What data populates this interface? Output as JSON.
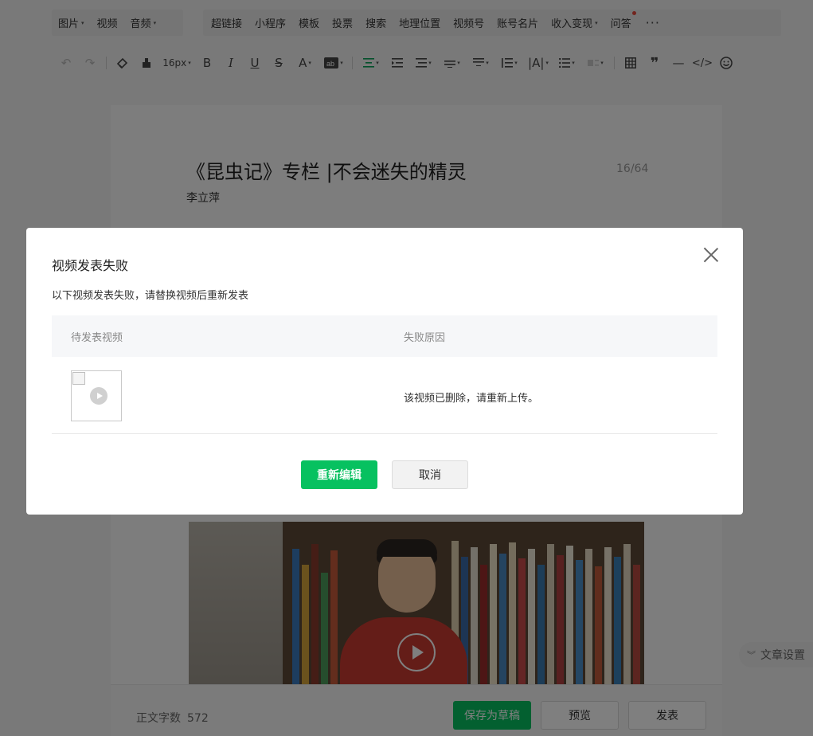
{
  "insert_bar": {
    "group1": [
      {
        "label": "图片",
        "caret": true
      },
      {
        "label": "视频",
        "caret": false
      },
      {
        "label": "音频",
        "caret": true
      }
    ],
    "group2": [
      {
        "label": "超链接",
        "caret": false
      },
      {
        "label": "小程序",
        "caret": false
      },
      {
        "label": "模板",
        "caret": false
      },
      {
        "label": "投票",
        "caret": false
      },
      {
        "label": "搜索",
        "caret": false
      },
      {
        "label": "地理位置",
        "caret": false
      },
      {
        "label": "视频号",
        "caret": false
      },
      {
        "label": "账号名片",
        "caret": false
      },
      {
        "label": "收入变现",
        "caret": true
      },
      {
        "label": "问答",
        "caret": false
      }
    ],
    "more": "···"
  },
  "format_toolbar": {
    "font_size": "16px"
  },
  "editor": {
    "title": "《昆虫记》专栏 |不会迷失的精灵",
    "title_count": "16/64",
    "author": "李立萍"
  },
  "footer": {
    "word_count_label": "正文字数",
    "word_count": "572",
    "save_label": "保存为草稿",
    "preview_label": "预览",
    "publish_label": "发表"
  },
  "side": {
    "settings_label": "文章设置"
  },
  "dialog": {
    "title": "视频发表失败",
    "description": "以下视频发表失败，请替换视频后重新发表",
    "columns": [
      "待发表视频",
      "失败原因"
    ],
    "rows": [
      {
        "reason": "该视频已删除，请重新上传。"
      }
    ],
    "primary_label": "重新编辑",
    "cancel_label": "取消"
  },
  "colors": {
    "brand_green": "#07c160",
    "mask": "rgba(0,0,0,0.5)",
    "notify_dot": "#e5483c"
  }
}
